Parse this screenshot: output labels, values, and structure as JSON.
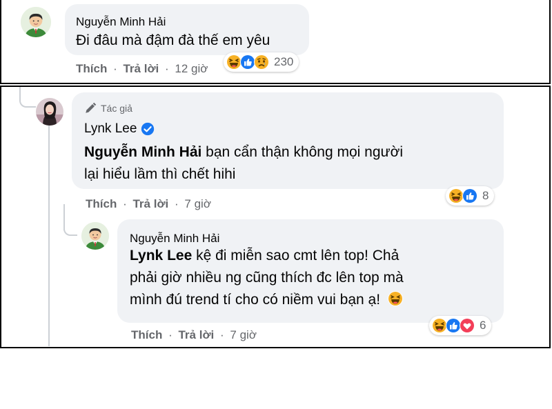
{
  "top_comment": {
    "author": "Nguyễn Minh Hải",
    "text": "Đi đâu mà đậm đà thế em yêu",
    "actions": {
      "like": "Thích",
      "reply": "Trả lời",
      "sep": "·",
      "time": "12 giờ"
    },
    "reactions": {
      "icons": [
        "haha-icon",
        "like-icon",
        "sad-icon"
      ],
      "count": "230"
    }
  },
  "author_reply": {
    "badge": "Tác giả",
    "author": "Lynk Lee",
    "mention": "Nguyễn Minh Hải",
    "text_line1": " bạn cẩn thận không mọi người",
    "text_line2": "lại hiểu lầm thì chết hihi",
    "actions": {
      "like": "Thích",
      "reply": "Trả lời",
      "sep": "·",
      "time": "7 giờ"
    },
    "reactions": {
      "icons": [
        "haha-icon",
        "like-icon"
      ],
      "count": "8"
    }
  },
  "nested_reply": {
    "author": "Nguyễn Minh Hải",
    "mention": "Lynk Lee",
    "text_line1": " kệ đi miễn sao cmt lên top! Chả",
    "text_line2": "phải giờ nhiều ng cũng thích đc lên top mà",
    "text_line3": "mình đú trend tí cho có niềm vui bạn ạ!",
    "actions": {
      "like": "Thích",
      "reply": "Trả lời",
      "sep": "·",
      "time": "7 giờ"
    },
    "reactions": {
      "icons": [
        "haha-icon",
        "like-icon",
        "love-icon"
      ],
      "count": "6"
    }
  },
  "colors": {
    "bubble": "#f0f2f5",
    "secondary_text": "#65676b",
    "verified_blue": "#1877f2",
    "like_blue": "#1877f2",
    "haha_yellow": "#f7b125",
    "love_red": "#f33e58"
  }
}
